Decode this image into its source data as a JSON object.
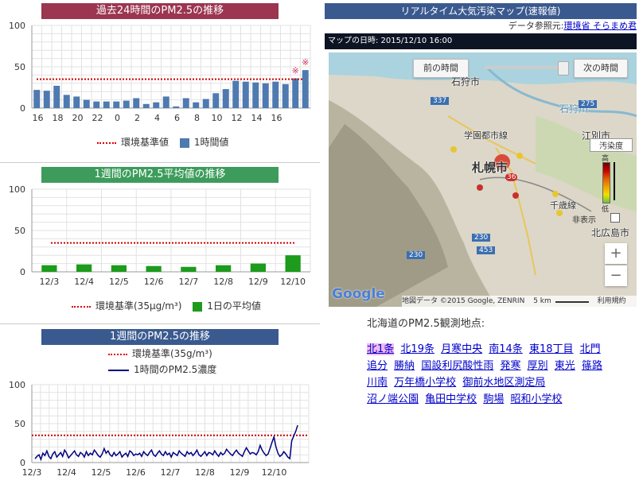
{
  "colors": {
    "title1": "#9b3550",
    "title2": "#3d9c5c",
    "title3": "#3a5a8f",
    "bar1": "#4f7ab0",
    "bar2": "#1c9b1c",
    "line3": "#000080",
    "standard": "#cc0000"
  },
  "chart1": {
    "title": "過去24時間のPM2.5の推移",
    "legend_standard": "環境基準値",
    "legend_series": "1時間値",
    "annotation_glyph": "※"
  },
  "chart2": {
    "title": "1週間のPM2.5平均値の推移",
    "legend_standard": "環境基準(35μg/m³)",
    "legend_series": "1日の平均値"
  },
  "chart3": {
    "title": "1週間のPM2.5の推移",
    "legend_standard": "環境基準(35g/m³)",
    "legend_series": "1時間のPM2.5濃度"
  },
  "chart_data": [
    {
      "type": "bar",
      "ylim": [
        0,
        100
      ],
      "yticks": [
        0,
        50,
        100
      ],
      "x": [
        15,
        16,
        17,
        18,
        19,
        20,
        21,
        22,
        23,
        0,
        1,
        2,
        3,
        4,
        5,
        6,
        7,
        8,
        9,
        10,
        11,
        12,
        13,
        14,
        15,
        16
      ],
      "xticklabels": [
        "16",
        "18",
        "20",
        "22",
        "0",
        "2",
        "4",
        "6",
        "8",
        "10",
        "12",
        "14",
        "16"
      ],
      "values": [
        22,
        21,
        27,
        16,
        14,
        10,
        8,
        8,
        8,
        9,
        12,
        5,
        7,
        14,
        2,
        12,
        7,
        11,
        18,
        23,
        33,
        32,
        31,
        30,
        32,
        29,
        36,
        46
      ],
      "standard": 35,
      "annotated_x": [
        14,
        16
      ]
    },
    {
      "type": "bar",
      "ylim": [
        0,
        100
      ],
      "yticks": [
        0,
        50,
        100
      ],
      "categories": [
        "12/3",
        "12/4",
        "12/5",
        "12/6",
        "12/7",
        "12/8",
        "12/9",
        "12/10"
      ],
      "values": [
        8,
        9,
        8,
        7,
        6,
        8,
        10,
        20
      ],
      "standard": 35
    },
    {
      "type": "line",
      "ylim": [
        0,
        100
      ],
      "yticks": [
        0,
        50,
        100
      ],
      "xticklabels": [
        "12/3",
        "12/4",
        "12/5",
        "12/6",
        "12/7",
        "12/8",
        "12/9",
        "12/10"
      ],
      "standard": 35,
      "values": [
        5,
        8,
        10,
        4,
        12,
        9,
        15,
        8,
        5,
        11,
        14,
        7,
        10,
        13,
        8,
        16,
        12,
        6,
        9,
        12,
        15,
        10,
        8,
        13,
        11,
        7,
        14,
        9,
        12,
        10,
        16,
        13,
        9,
        7,
        11,
        18,
        12,
        15,
        10,
        8,
        13,
        9,
        11,
        14,
        7,
        10,
        12,
        8,
        15,
        13,
        9,
        11,
        10,
        12,
        8,
        14,
        11,
        9,
        13,
        16,
        10,
        8,
        12,
        15,
        11,
        9,
        14,
        10,
        12,
        7,
        13,
        11,
        9,
        15,
        12,
        10,
        8,
        14,
        11,
        13,
        9,
        12,
        16,
        10,
        8,
        11,
        14,
        9,
        13,
        12,
        10,
        15,
        11,
        8,
        13,
        10,
        12,
        17,
        14,
        11,
        9,
        13,
        16,
        12,
        10,
        8,
        14,
        19,
        15,
        11,
        13,
        12,
        10,
        14,
        22,
        16,
        12,
        9,
        11,
        18,
        26,
        33,
        20,
        12,
        8,
        10,
        14,
        11,
        7,
        5,
        28,
        34,
        40,
        48
      ]
    }
  ],
  "map": {
    "title": "リアルタイム大気汚染マップ(速報値)",
    "source_label": "データ参照元:",
    "source_link": "環境省 そらまめ君",
    "datetime_label": "マップの日時: 2015/12/10 16:00",
    "prev_button": "前の時間",
    "next_button": "次の時間",
    "legend_title": "汚染度",
    "legend_high": "高",
    "legend_low": "低",
    "hide_label": "非表示",
    "zoom_in": "+",
    "zoom_out": "−",
    "google": "Google",
    "footer": "地図データ ©2015 Google, ZENRIN",
    "scale": "5 km",
    "terms": "利用規約",
    "labels": {
      "ishikari": "石狩市",
      "sapporo": "札幌市",
      "ebetsu": "江別市",
      "kitahiroshima": "北広島市",
      "ishikari_river": "石狩川",
      "sassho_line": "学園都市線",
      "chitose_line": "千歳線",
      "road337": "337",
      "road275": "275",
      "road230a": "230",
      "road230b": "230",
      "road453": "453",
      "r36": "36"
    }
  },
  "stations": {
    "heading": "北海道のPM2.5観測地点:",
    "items": [
      "北1条",
      "北19条",
      "月寒中央",
      "南14条",
      "東18丁目",
      "北門",
      "追分",
      "勝納",
      "国設利尻酸性雨",
      "発寒",
      "厚別",
      "東光",
      "篠路",
      "川南",
      "万年橋小学校",
      "御前水地区測定局",
      "沼ノ端公園",
      "亀田中学校",
      "駒場",
      "昭和小学校"
    ]
  }
}
